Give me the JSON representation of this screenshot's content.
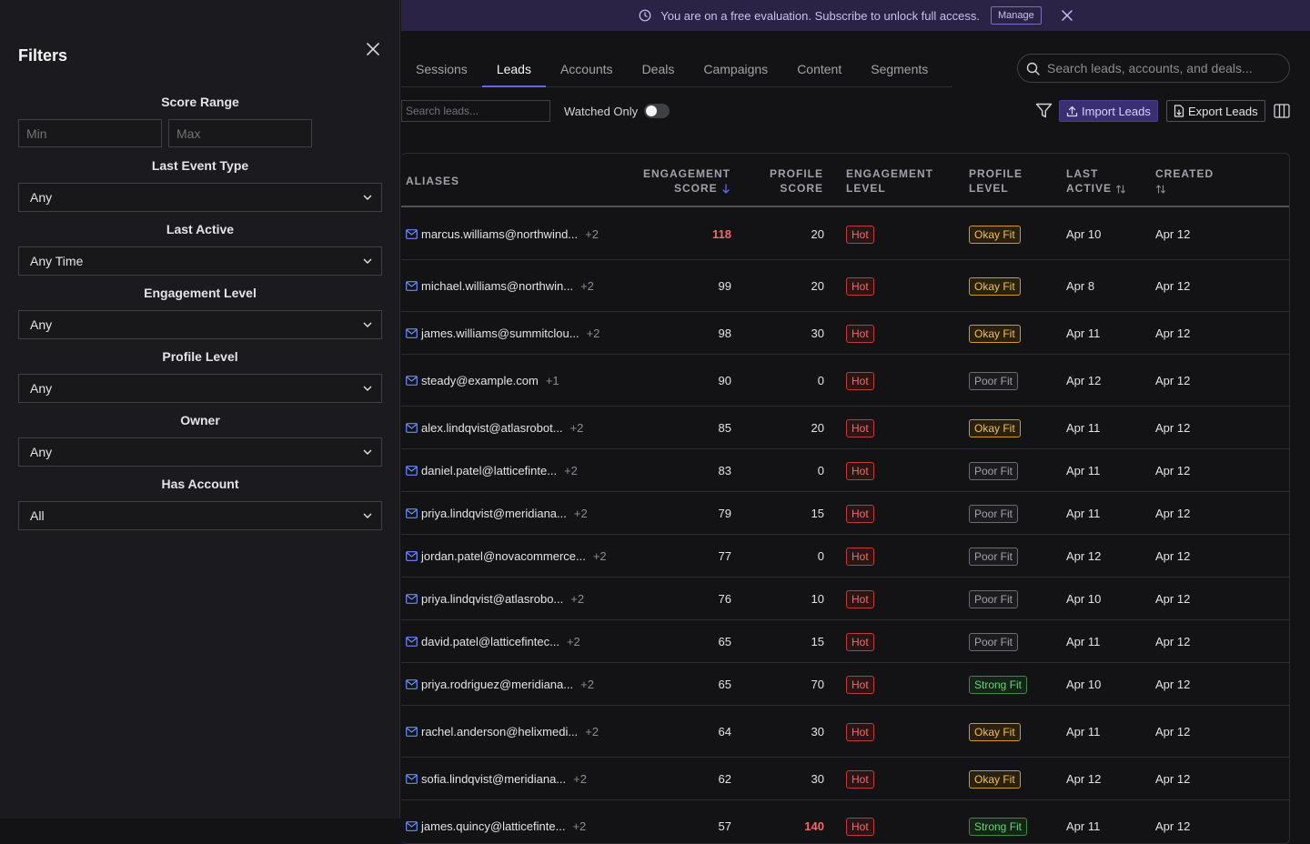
{
  "filters": {
    "title": "Filters",
    "score_range": {
      "label": "Score Range",
      "min_placeholder": "Min",
      "max_placeholder": "Max"
    },
    "last_event_type": {
      "label": "Last Event Type",
      "value": "Any"
    },
    "last_active": {
      "label": "Last Active",
      "value": "Any Time"
    },
    "engagement_level": {
      "label": "Engagement Level",
      "value": "Any"
    },
    "profile_level": {
      "label": "Profile Level",
      "value": "Any"
    },
    "owner": {
      "label": "Owner",
      "value": "Any"
    },
    "has_account": {
      "label": "Has Account",
      "value": "All"
    }
  },
  "banner": {
    "message": "You are on a free evaluation. Subscribe to unlock full access.",
    "manage_label": "Manage"
  },
  "tabs": [
    "Sessions",
    "Leads",
    "Accounts",
    "Deals",
    "Campaigns",
    "Content",
    "Segments"
  ],
  "active_tab": "Leads",
  "global_search": {
    "placeholder": "Search leads, accounts, and deals..."
  },
  "toolbar": {
    "lead_search_placeholder": "Search leads...",
    "watched_only_label": "Watched Only",
    "watched_only": false,
    "import_label": "Import Leads",
    "export_label": "Export Leads"
  },
  "table": {
    "headers": {
      "aliases": "ALIASES",
      "engagement_score": [
        "ENGAGEMENT",
        "SCORE"
      ],
      "profile_score": [
        "PROFILE",
        "SCORE"
      ],
      "engagement_level": [
        "ENGAGEMENT",
        "LEVEL"
      ],
      "profile_level": [
        "PROFILE",
        "LEVEL"
      ],
      "last_active": [
        "LAST",
        "ACTIVE"
      ],
      "created": "CREATED"
    },
    "rows": [
      {
        "alias": "marcus.williams@northwind...",
        "more": "+2",
        "eng": "118",
        "prof": "20",
        "level": "Hot",
        "fit": "Okay Fit",
        "last": "Apr 10",
        "created": "Apr 12",
        "highlight": true
      },
      {
        "alias": "michael.williams@northwin...",
        "more": "+2",
        "eng": "99",
        "prof": "20",
        "level": "Hot",
        "fit": "Okay Fit",
        "last": "Apr 8",
        "created": "Apr 12"
      },
      {
        "alias": "james.williams@summitclou...",
        "more": "+2",
        "eng": "98",
        "prof": "30",
        "level": "Hot",
        "fit": "Okay Fit",
        "last": "Apr 11",
        "created": "Apr 12"
      },
      {
        "alias": "steady@example.com",
        "more": "+1",
        "eng": "90",
        "prof": "0",
        "level": "Hot",
        "fit": "Poor Fit",
        "last": "Apr 12",
        "created": "Apr 12"
      },
      {
        "alias": "alex.lindqvist@atlasrobot...",
        "more": "+2",
        "eng": "85",
        "prof": "20",
        "level": "Hot",
        "fit": "Okay Fit",
        "last": "Apr 11",
        "created": "Apr 12"
      },
      {
        "alias": "daniel.patel@latticefinte...",
        "more": "+2",
        "eng": "83",
        "prof": "0",
        "level": "Hot",
        "fit": "Poor Fit",
        "last": "Apr 11",
        "created": "Apr 12"
      },
      {
        "alias": "priya.lindqvist@meridiana...",
        "more": "+2",
        "eng": "79",
        "prof": "15",
        "level": "Hot",
        "fit": "Poor Fit",
        "last": "Apr 11",
        "created": "Apr 12"
      },
      {
        "alias": "jordan.patel@novacommerce...",
        "more": "+2",
        "eng": "77",
        "prof": "0",
        "level": "Hot",
        "fit": "Poor Fit",
        "last": "Apr 12",
        "created": "Apr 12"
      },
      {
        "alias": "priya.lindqvist@atlasrobo...",
        "more": "+2",
        "eng": "76",
        "prof": "10",
        "level": "Hot",
        "fit": "Poor Fit",
        "last": "Apr 10",
        "created": "Apr 12"
      },
      {
        "alias": "david.patel@latticefintec...",
        "more": "+2",
        "eng": "65",
        "prof": "15",
        "level": "Hot",
        "fit": "Poor Fit",
        "last": "Apr 11",
        "created": "Apr 12"
      },
      {
        "alias": "priya.rodriguez@meridiana...",
        "more": "+2",
        "eng": "65",
        "prof": "70",
        "level": "Hot",
        "fit": "Strong Fit",
        "last": "Apr 10",
        "created": "Apr 12"
      },
      {
        "alias": "rachel.anderson@helixmedi...",
        "more": "+2",
        "eng": "64",
        "prof": "30",
        "level": "Hot",
        "fit": "Okay Fit",
        "last": "Apr 11",
        "created": "Apr 12"
      },
      {
        "alias": "sofia.lindqvist@meridiana...",
        "more": "+2",
        "eng": "62",
        "prof": "30",
        "level": "Hot",
        "fit": "Okay Fit",
        "last": "Apr 12",
        "created": "Apr 12"
      },
      {
        "alias": "james.quincy@latticefinte...",
        "more": "+2",
        "eng": "57",
        "prof": "140",
        "level": "Hot",
        "fit": "Strong Fit",
        "last": "Apr 11",
        "created": "Apr 12",
        "prof_highlight": true
      }
    ]
  },
  "colors": {
    "accent": "#6366f1",
    "hot": "#ef6b6b",
    "okay_fit": "#f4c04a",
    "poor_fit": "#a1a1aa",
    "strong_fit": "#6fd07a",
    "banner_bg": "#2a2345"
  },
  "icons": {
    "close": "close-icon",
    "dropdown": "chevron-down-icon",
    "banner_info": "clock-icon",
    "search": "search-icon",
    "filter": "filter-icon",
    "import": "upload-icon",
    "export": "file-export-icon",
    "columns": "columns-icon",
    "email": "mail-icon",
    "sort": "sort-icon"
  }
}
